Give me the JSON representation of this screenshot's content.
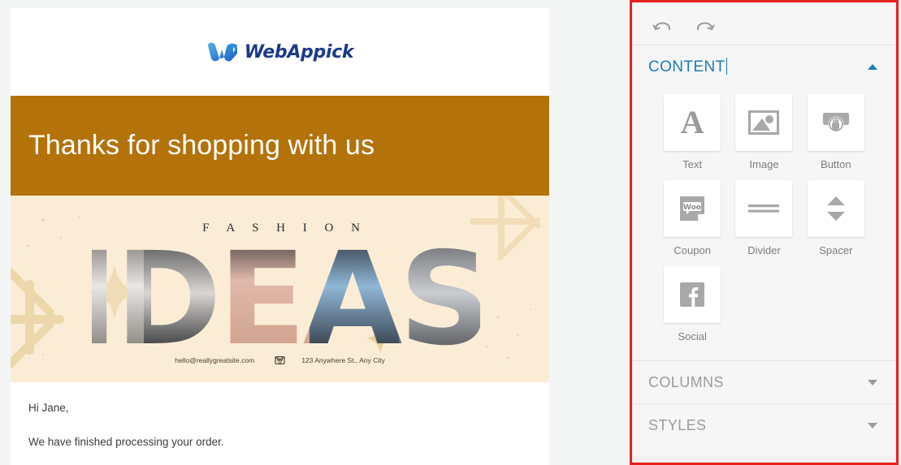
{
  "email_preview": {
    "logo": {
      "icon": "webappick-w-logo",
      "text": "WebAppick"
    },
    "banner": {
      "title": "Thanks for shopping with us",
      "bg_color": "#b3720a"
    },
    "hero": {
      "kicker": "F A S H I O N",
      "headline": "IDEAS",
      "email": "hello@reallygreatsite.com",
      "address": "123 Anywhere St., Any City",
      "bg_color": "#fbedd5"
    },
    "body": {
      "greeting": "Hi Jane,",
      "line1": "We have finished processing your order."
    }
  },
  "sidebar": {
    "toolbar": {
      "undo": {
        "name": "undo",
        "label": "Undo"
      },
      "redo": {
        "name": "redo",
        "label": "Redo"
      }
    },
    "sections": [
      {
        "title": "CONTENT",
        "state": "expanded",
        "caret": "up",
        "accent": "#1a7bb9"
      },
      {
        "title": "COLUMNS",
        "state": "collapsed",
        "caret": "down"
      },
      {
        "title": "STYLES",
        "state": "collapsed",
        "caret": "down"
      }
    ],
    "blocks": [
      {
        "label": "Text",
        "icon": "text-a-icon"
      },
      {
        "label": "Image",
        "icon": "image-picture-icon"
      },
      {
        "label": "Button",
        "icon": "button-pointer-icon"
      },
      {
        "label": "Coupon",
        "icon": "woocommerce-coupon-icon"
      },
      {
        "label": "Divider",
        "icon": "divider-lines-icon"
      },
      {
        "label": "Spacer",
        "icon": "spacer-arrows-icon"
      },
      {
        "label": "Social",
        "icon": "facebook-social-icon"
      }
    ]
  },
  "highlight": {
    "border_color": "#e8201b"
  }
}
